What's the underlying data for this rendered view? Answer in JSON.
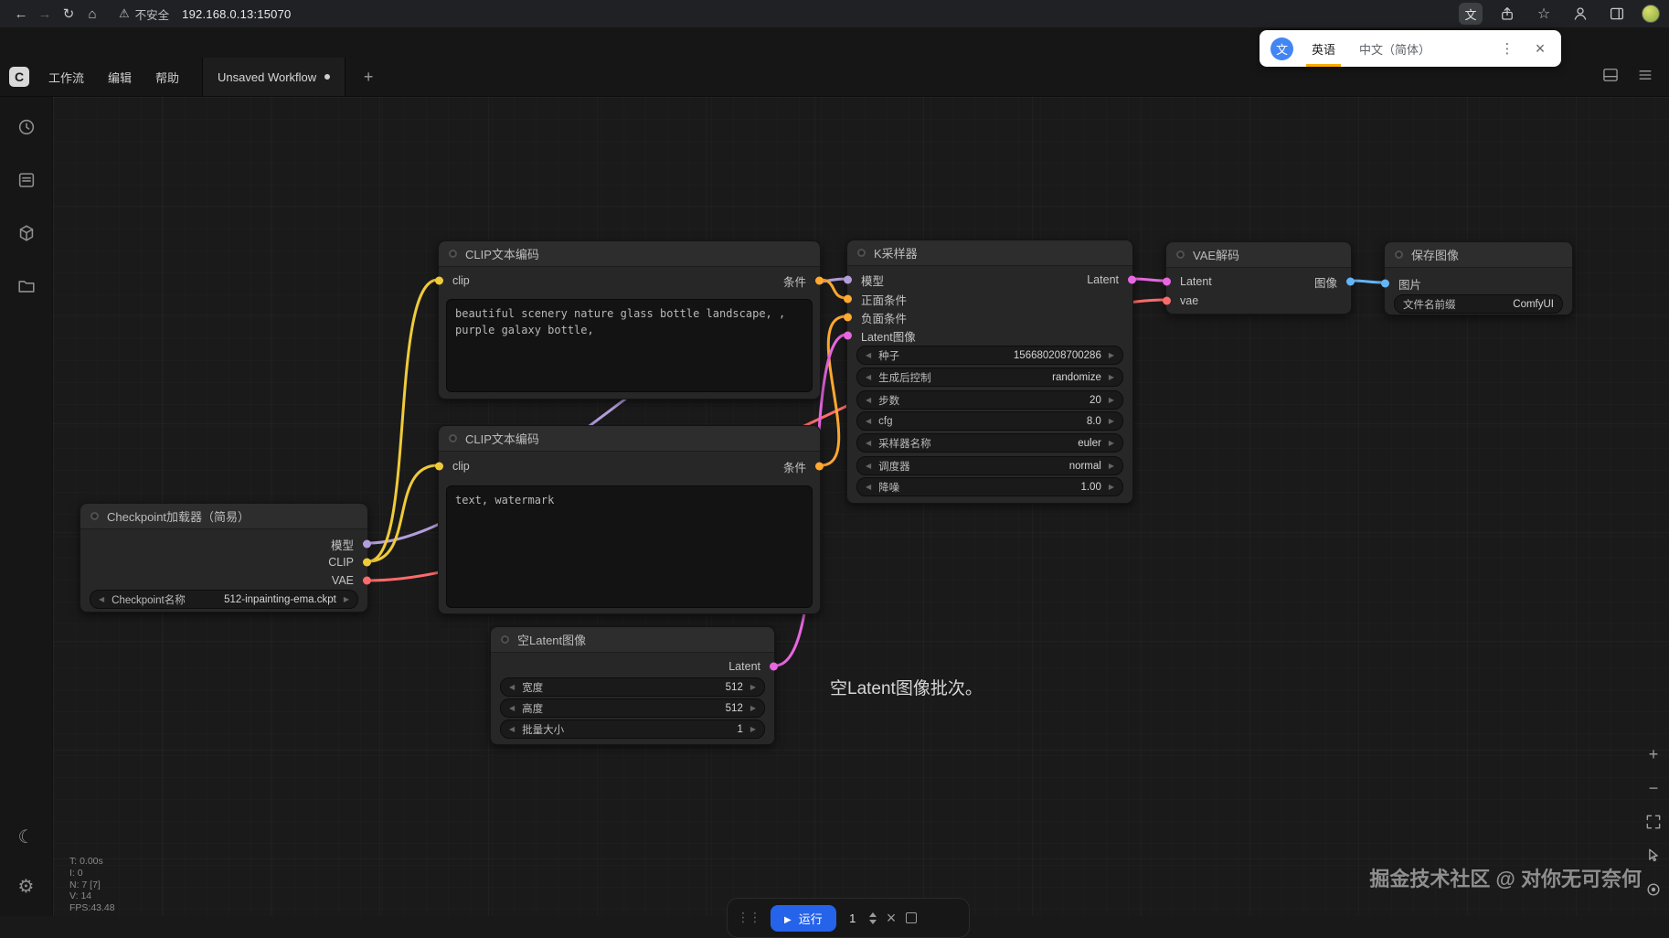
{
  "browser": {
    "url": "192.168.0.13:15070",
    "security_label": "不安全"
  },
  "translate_popup": {
    "source_lang_tab": "英语",
    "target_lang_tab": "中文（简体）"
  },
  "menubar": {
    "logo_letter": "C",
    "menus": [
      "工作流",
      "编辑",
      "帮助"
    ],
    "workflow_tab": "Unsaved Workflow"
  },
  "canvas_stats": [
    "T: 0.00s",
    "I: 0",
    "N: 7 [7]",
    "V: 14",
    "FPS:43.48"
  ],
  "note_text": "空Latent图像批次。",
  "watermark": "掘金技术社区 @ 对你无可奈何",
  "run_toolbar": {
    "run_label": "运行",
    "batch_count": "1"
  },
  "nodes": {
    "checkpoint": {
      "title": "Checkpoint加载器（简易）",
      "outputs": [
        "模型",
        "CLIP",
        "VAE"
      ],
      "widget": {
        "label": "Checkpoint名称",
        "value": "512-inpainting-ema.ckpt"
      }
    },
    "clip_pos": {
      "title": "CLIP文本编码",
      "input": "clip",
      "output": "条件",
      "text": "beautiful scenery nature glass bottle landscape, , purple galaxy bottle,"
    },
    "clip_neg": {
      "title": "CLIP文本编码",
      "input": "clip",
      "output": "条件",
      "text": "text, watermark"
    },
    "ksampler": {
      "title": "K采样器",
      "inputs": [
        "模型",
        "正面条件",
        "负面条件",
        "Latent图像"
      ],
      "output": "Latent",
      "widgets": [
        {
          "label": "种子",
          "value": "156680208700286"
        },
        {
          "label": "生成后控制",
          "value": "randomize"
        },
        {
          "label": "步数",
          "value": "20"
        },
        {
          "label": "cfg",
          "value": "8.0"
        },
        {
          "label": "采样器名称",
          "value": "euler"
        },
        {
          "label": "调度器",
          "value": "normal"
        },
        {
          "label": "降噪",
          "value": "1.00"
        }
      ]
    },
    "vae_decode": {
      "title": "VAE解码",
      "inputs": [
        "Latent",
        "vae"
      ],
      "output": "图像"
    },
    "save_image": {
      "title": "保存图像",
      "input": "图片",
      "widget": {
        "label": "文件名前缀",
        "value": "ComfyUI"
      }
    },
    "empty_latent": {
      "title": "空Latent图像",
      "output": "Latent",
      "widgets": [
        {
          "label": "宽度",
          "value": "512"
        },
        {
          "label": "高度",
          "value": "512"
        },
        {
          "label": "批量大小",
          "value": "1"
        }
      ]
    }
  },
  "colors": {
    "link_model": "#B39DDB",
    "link_clip": "#EFCB3A",
    "link_vae": "#FF6B6B",
    "link_conditioning": "#FFA931",
    "link_latent": "#E767E0",
    "link_image": "#64B5F6",
    "run_button": "#2563eb",
    "translate_tab_indicator": "#F9AB00"
  }
}
